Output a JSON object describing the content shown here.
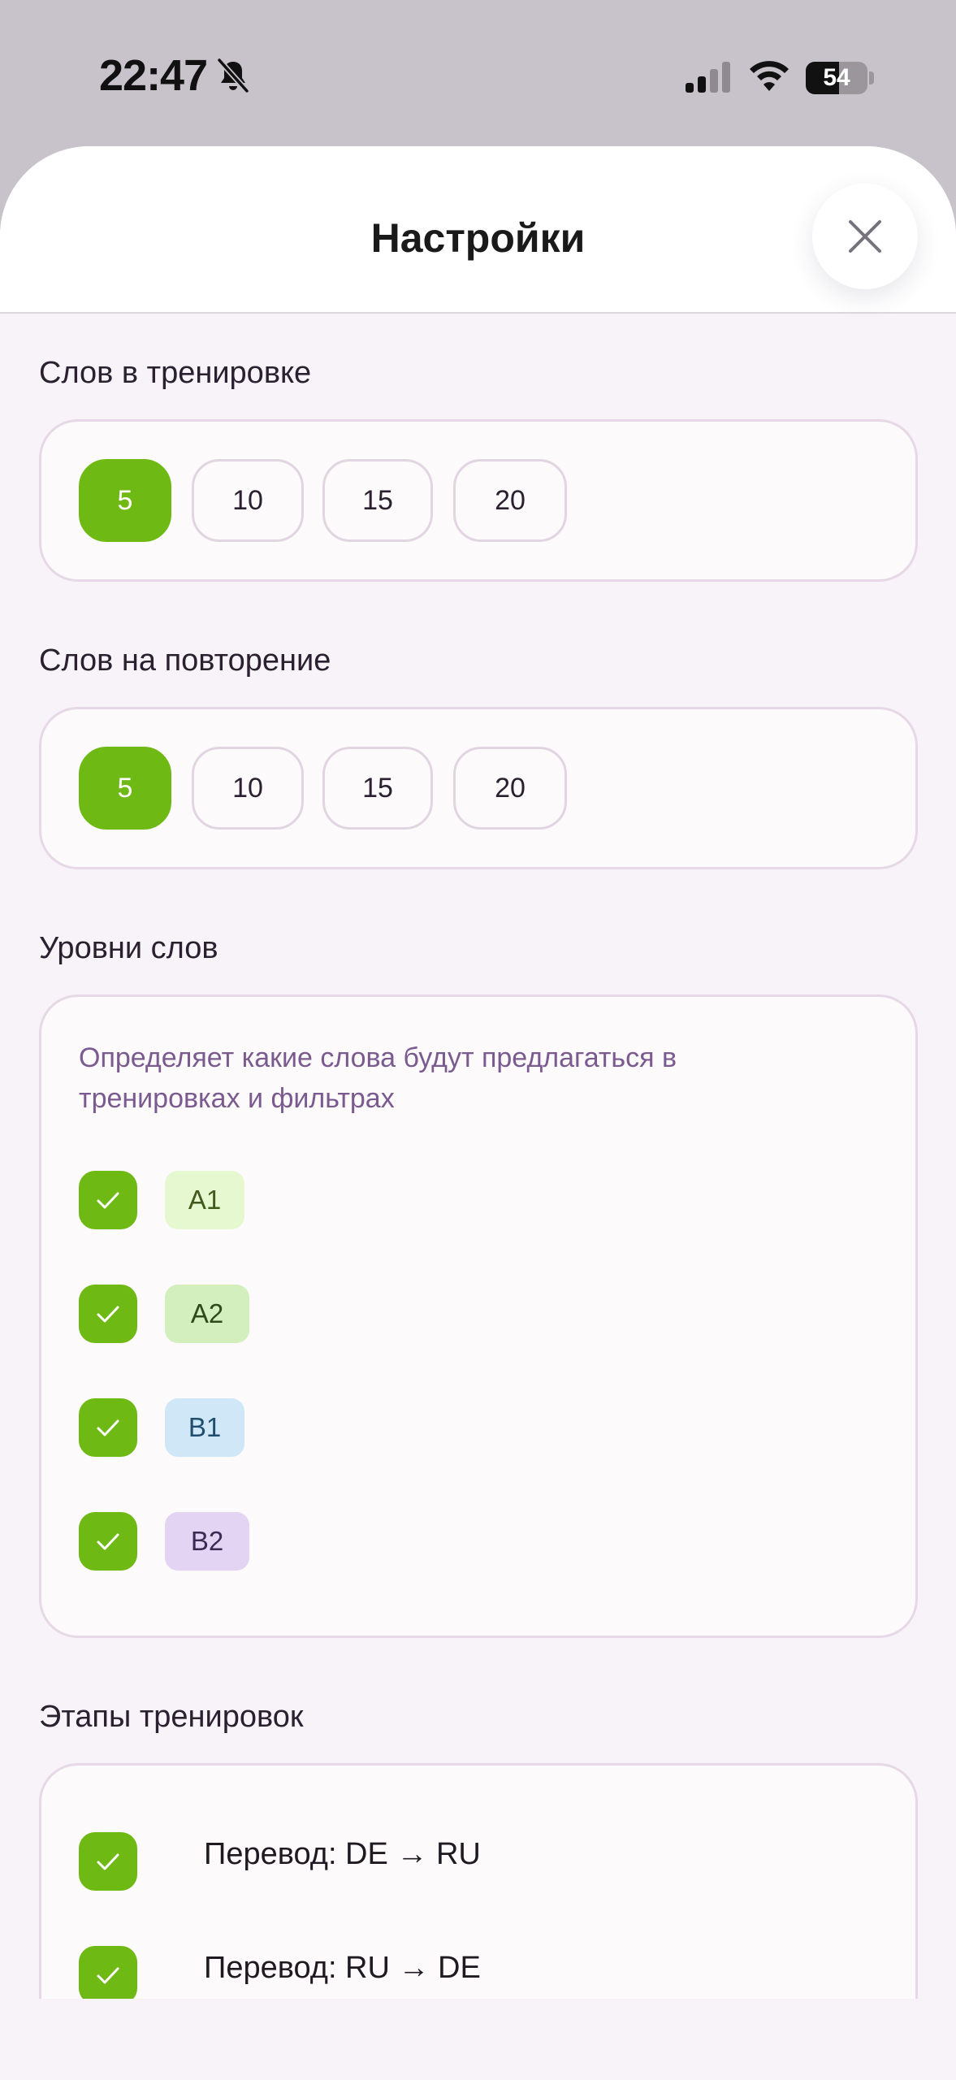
{
  "status_bar": {
    "time": "22:47",
    "battery_level": "54",
    "battery_fraction": 0.54,
    "icons": [
      "bell-slash-icon",
      "cellular-signal-icon",
      "wifi-icon",
      "battery-icon"
    ]
  },
  "header": {
    "title": "Настройки",
    "close_icon": "close-icon"
  },
  "colors": {
    "accent": "#6fb914",
    "sheet_bg": "#f8f3f8",
    "card_border": "#e6d8e6",
    "description": "#7a5a8f"
  },
  "words_in_training": {
    "label": "Слов в тренировке",
    "options": [
      "5",
      "10",
      "15",
      "20"
    ],
    "selected": "5"
  },
  "words_for_review": {
    "label": "Слов на повторение",
    "options": [
      "5",
      "10",
      "15",
      "20"
    ],
    "selected": "5"
  },
  "word_levels": {
    "label": "Уровни слов",
    "description": "Определяет какие слова будут предлагаться в тренировках и фильтрах",
    "levels": [
      {
        "label": "A1",
        "checked": true,
        "bg": "#e6f8cf",
        "fg": "#3f5a1c"
      },
      {
        "label": "A2",
        "checked": true,
        "bg": "#d3efbd",
        "fg": "#2f4a1a"
      },
      {
        "label": "B1",
        "checked": true,
        "bg": "#cfe7f6",
        "fg": "#1f4e6e"
      },
      {
        "label": "B2",
        "checked": true,
        "bg": "#e2d4f2",
        "fg": "#3c2a55"
      }
    ]
  },
  "training_stages": {
    "label": "Этапы тренировок",
    "stages": [
      {
        "label": "Перевод: DE → RU",
        "checked": true
      },
      {
        "label": "Перевод: RU → DE",
        "checked": true
      }
    ]
  }
}
